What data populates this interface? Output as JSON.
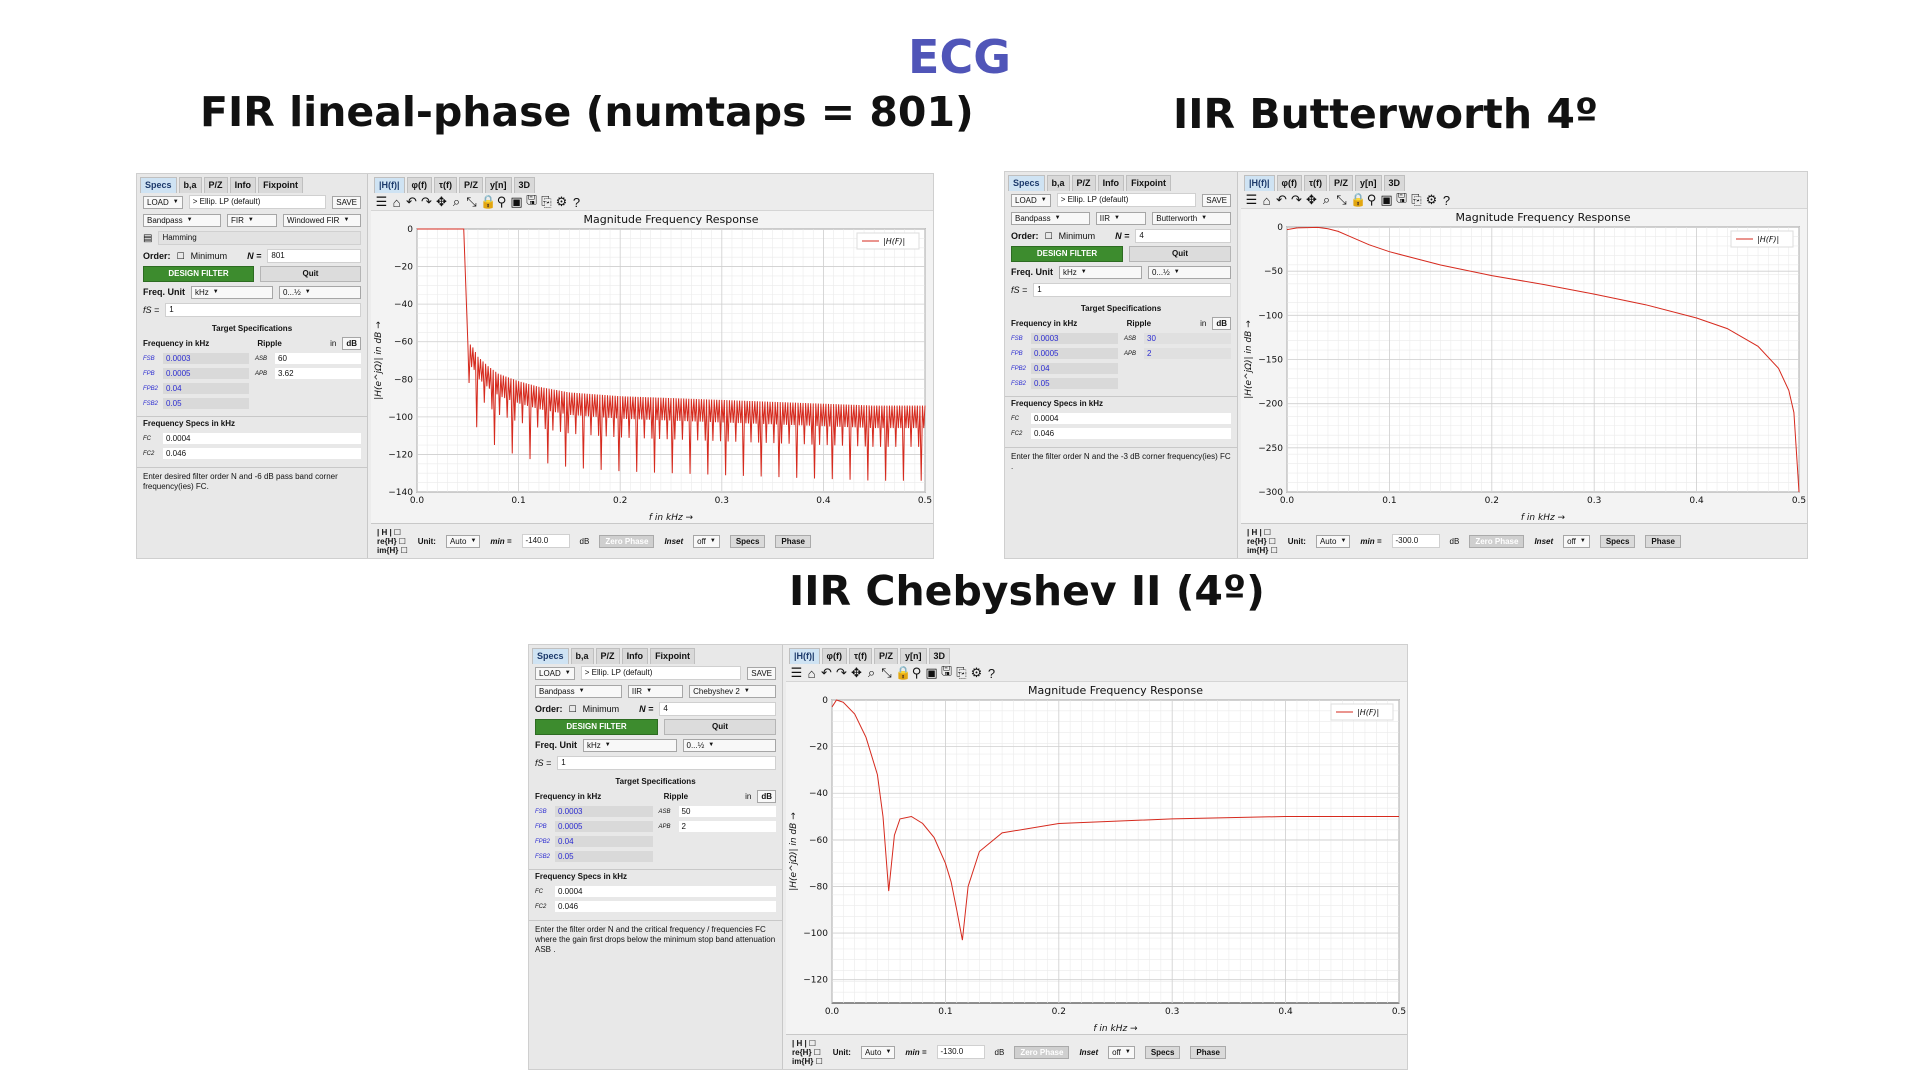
{
  "page_title": "ECG",
  "panels": [
    {
      "heading": "FIR lineal-phase (numtaps = 801)",
      "tabs": [
        "Specs",
        "b,a",
        "P/Z",
        "Info",
        "Fixpoint"
      ],
      "load_label": "LOAD",
      "filter_name": "> Ellip. LP (default)",
      "save_label": "SAVE",
      "response_type": "Bandpass",
      "filter_class": "FIR",
      "design_method": "Windowed FIR",
      "window_label": "Hamming",
      "order_label": "Order:",
      "minimum_label": "Minimum",
      "n_label": "N =",
      "n_value": "801",
      "design_button": "DESIGN FILTER",
      "quit_button": "Quit",
      "freq_unit_label": "Freq. Unit",
      "freq_unit": "kHz",
      "freq_range": "0...½",
      "fs_label": "fS =",
      "fs_value": "1",
      "target_title": "Target Specifications",
      "freq_col": "Frequency in kHz",
      "ripple_col": "Ripple",
      "in_label": "in",
      "db_label": "dB",
      "freqs": [
        {
          "label": "FSB",
          "value": "0.0003"
        },
        {
          "label": "FPB",
          "value": "0.0005"
        },
        {
          "label": "FPB2",
          "value": "0.04"
        },
        {
          "label": "FSB2",
          "value": "0.05"
        }
      ],
      "ripples": [
        {
          "label": "ASB",
          "value": "60"
        },
        {
          "label": "APB",
          "value": "3.62"
        }
      ],
      "freq_specs_title": "Frequency Specs in kHz",
      "freq_specs": [
        {
          "label": "FC",
          "value": "0.0004"
        },
        {
          "label": "FC2",
          "value": "0.046"
        }
      ],
      "hint": "Enter desired filter order N and -6 dB pass band corner frequency(ies) FC.",
      "plot_tabs": [
        "|H(f)|",
        "φ(f)",
        "τ(f)",
        "P/Z",
        "y[n]",
        "3D"
      ],
      "plot_title": "Magnitude Frequency Response",
      "x_label": "f in kHz →",
      "y_label": "|H(e^jΩ)| in dB →",
      "legend": "|H(F)|",
      "bottom": {
        "h_label": "| H |",
        "re_label": "re{H}",
        "im_label": "im{H}",
        "unit_label": "Unit:",
        "unit_value": "Auto",
        "min_label": "min =",
        "min_value": "-140.0",
        "db_unit": "dB",
        "zero_phase": "Zero Phase",
        "inset_label": "Inset",
        "inset_value": "off",
        "specs_button": "Specs",
        "phase_button": "Phase"
      }
    },
    {
      "heading": "IIR Butterworth 4º",
      "tabs": [
        "Specs",
        "b,a",
        "P/Z",
        "Info",
        "Fixpoint"
      ],
      "load_label": "LOAD",
      "filter_name": "> Ellip. LP (default)",
      "save_label": "SAVE",
      "response_type": "Bandpass",
      "filter_class": "IIR",
      "design_method": "Butterworth",
      "window_label": "",
      "order_label": "Order:",
      "minimum_label": "Minimum",
      "n_label": "N =",
      "n_value": "4",
      "design_button": "DESIGN FILTER",
      "quit_button": "Quit",
      "freq_unit_label": "Freq. Unit",
      "freq_unit": "kHz",
      "freq_range": "0...½",
      "fs_label": "fS =",
      "fs_value": "1",
      "target_title": "Target Specifications",
      "freq_col": "Frequency in kHz",
      "ripple_col": "Ripple",
      "in_label": "in",
      "db_label": "dB",
      "freqs": [
        {
          "label": "FSB",
          "value": "0.0003"
        },
        {
          "label": "FPB",
          "value": "0.0005"
        },
        {
          "label": "FPB2",
          "value": "0.04"
        },
        {
          "label": "FSB2",
          "value": "0.05"
        }
      ],
      "ripples": [
        {
          "label": "ASB",
          "value": "30"
        },
        {
          "label": "APB",
          "value": "2"
        }
      ],
      "freq_specs_title": "Frequency Specs in kHz",
      "freq_specs": [
        {
          "label": "FC",
          "value": "0.0004"
        },
        {
          "label": "FC2",
          "value": "0.046"
        }
      ],
      "hint": "Enter the filter order N and the -3 dB corner frequency(ies) FC .",
      "plot_tabs": [
        "|H(f)|",
        "φ(f)",
        "τ(f)",
        "P/Z",
        "y[n]",
        "3D"
      ],
      "plot_title": "Magnitude Frequency Response",
      "x_label": "f in kHz →",
      "y_label": "|H(e^jΩ)| in dB →",
      "legend": "|H(F)|",
      "bottom": {
        "h_label": "| H |",
        "re_label": "re{H}",
        "im_label": "im{H}",
        "unit_label": "Unit:",
        "unit_value": "Auto",
        "min_label": "min =",
        "min_value": "-300.0",
        "db_unit": "dB",
        "zero_phase": "Zero Phase",
        "inset_label": "Inset",
        "inset_value": "off",
        "specs_button": "Specs",
        "phase_button": "Phase"
      }
    },
    {
      "heading": "IIR Chebyshev II (4º)",
      "tabs": [
        "Specs",
        "b,a",
        "P/Z",
        "Info",
        "Fixpoint"
      ],
      "load_label": "LOAD",
      "filter_name": "> Ellip. LP (default)",
      "save_label": "SAVE",
      "response_type": "Bandpass",
      "filter_class": "IIR",
      "design_method": "Chebyshev 2",
      "window_label": "",
      "order_label": "Order:",
      "minimum_label": "Minimum",
      "n_label": "N =",
      "n_value": "4",
      "design_button": "DESIGN FILTER",
      "quit_button": "Quit",
      "freq_unit_label": "Freq. Unit",
      "freq_unit": "kHz",
      "freq_range": "0...½",
      "fs_label": "fS =",
      "fs_value": "1",
      "target_title": "Target Specifications",
      "freq_col": "Frequency in kHz",
      "ripple_col": "Ripple",
      "in_label": "in",
      "db_label": "dB",
      "freqs": [
        {
          "label": "FSB",
          "value": "0.0003"
        },
        {
          "label": "FPB",
          "value": "0.0005"
        },
        {
          "label": "FPB2",
          "value": "0.04"
        },
        {
          "label": "FSB2",
          "value": "0.05"
        }
      ],
      "ripples": [
        {
          "label": "ASB",
          "value": "50"
        },
        {
          "label": "APB",
          "value": "2"
        }
      ],
      "freq_specs_title": "Frequency Specs in kHz",
      "freq_specs": [
        {
          "label": "FC",
          "value": "0.0004"
        },
        {
          "label": "FC2",
          "value": "0.046"
        }
      ],
      "hint": "Enter the filter order N and the critical frequency / frequencies FC where the gain first drops below the minimum stop band attenuation ASB .",
      "plot_tabs": [
        "|H(f)|",
        "φ(f)",
        "τ(f)",
        "P/Z",
        "y[n]",
        "3D"
      ],
      "plot_title": "Magnitude Frequency Response",
      "x_label": "f in kHz →",
      "y_label": "|H(e^jΩ)| in dB →",
      "legend": "|H(F)|",
      "bottom": {
        "h_label": "| H |",
        "re_label": "re{H}",
        "im_label": "im{H}",
        "unit_label": "Unit:",
        "unit_value": "Auto",
        "min_label": "min =",
        "min_value": "-130.0",
        "db_unit": "dB",
        "zero_phase": "Zero Phase",
        "inset_label": "Inset",
        "inset_value": "off",
        "specs_button": "Specs",
        "phase_button": "Phase"
      }
    }
  ],
  "chart_data": [
    {
      "type": "line",
      "title": "Magnitude Frequency Response",
      "xlabel": "f in kHz →",
      "ylabel": "|H(e^jΩ)| in dB →",
      "xlim": [
        0,
        0.5
      ],
      "ylim": [
        -140,
        0
      ],
      "xticks": [
        0.0,
        0.1,
        0.2,
        0.3,
        0.4,
        0.5
      ],
      "yticks": [
        0,
        -20,
        -40,
        -60,
        -80,
        -100,
        -120,
        -140
      ],
      "grid": true,
      "legend_position": "top-right",
      "color": "#d62a1e",
      "series": [
        {
          "name": "|H(F)|",
          "x": [
            0.0,
            0.04,
            0.046,
            0.05,
            0.055,
            0.06,
            0.07,
            0.08,
            0.1,
            0.12,
            0.15,
            0.2,
            0.25,
            0.3,
            0.35,
            0.4,
            0.45,
            0.5
          ],
          "y": [
            0,
            0,
            -20,
            -60,
            -63,
            -68,
            -73,
            -77,
            -81,
            -84,
            -87,
            -89,
            -90,
            -91,
            -92,
            -93,
            -94,
            -94
          ],
          "notes_ripple_depth_db": 18
        }
      ]
    },
    {
      "type": "line",
      "title": "Magnitude Frequency Response",
      "xlabel": "f in kHz →",
      "ylabel": "|H(e^jΩ)| in dB →",
      "xlim": [
        0,
        0.5
      ],
      "ylim": [
        -300,
        0
      ],
      "xticks": [
        0.0,
        0.1,
        0.2,
        0.3,
        0.4,
        0.5
      ],
      "yticks": [
        0,
        -50,
        -100,
        -150,
        -200,
        -250,
        -300
      ],
      "grid": true,
      "legend_position": "top-right",
      "color": "#d62a1e",
      "series": [
        {
          "name": "|H(F)|",
          "x": [
            0.0,
            0.01,
            0.03,
            0.04,
            0.05,
            0.06,
            0.08,
            0.1,
            0.15,
            0.2,
            0.25,
            0.3,
            0.35,
            0.4,
            0.43,
            0.46,
            0.48,
            0.49,
            0.495,
            0.5
          ],
          "y": [
            -3,
            -1,
            -0.5,
            -2,
            -5,
            -10,
            -20,
            -28,
            -43,
            -55,
            -65,
            -76,
            -88,
            -103,
            -115,
            -135,
            -160,
            -185,
            -210,
            -300
          ]
        }
      ]
    },
    {
      "type": "line",
      "title": "Magnitude Frequency Response",
      "xlabel": "f in kHz →",
      "ylabel": "|H(e^jΩ)| in dB →",
      "xlim": [
        0,
        0.5
      ],
      "ylim": [
        -130,
        0
      ],
      "xticks": [
        0.0,
        0.1,
        0.2,
        0.3,
        0.4,
        0.5
      ],
      "yticks": [
        0,
        -20,
        -40,
        -60,
        -80,
        -100,
        -120
      ],
      "grid": true,
      "legend_position": "top-right",
      "color": "#d62a1e",
      "series": [
        {
          "name": "|H(F)|",
          "x": [
            0.0,
            0.004,
            0.01,
            0.02,
            0.03,
            0.04,
            0.045,
            0.05,
            0.055,
            0.06,
            0.07,
            0.08,
            0.09,
            0.1,
            0.105,
            0.11,
            0.115,
            0.12,
            0.13,
            0.15,
            0.2,
            0.3,
            0.4,
            0.5
          ],
          "y": [
            -3,
            0,
            -1,
            -6,
            -16,
            -32,
            -50,
            -82,
            -58,
            -51,
            -50,
            -53,
            -59,
            -70,
            -78,
            -90,
            -103,
            -80,
            -65,
            -57,
            -53,
            -51,
            -50,
            -50
          ]
        }
      ]
    }
  ]
}
